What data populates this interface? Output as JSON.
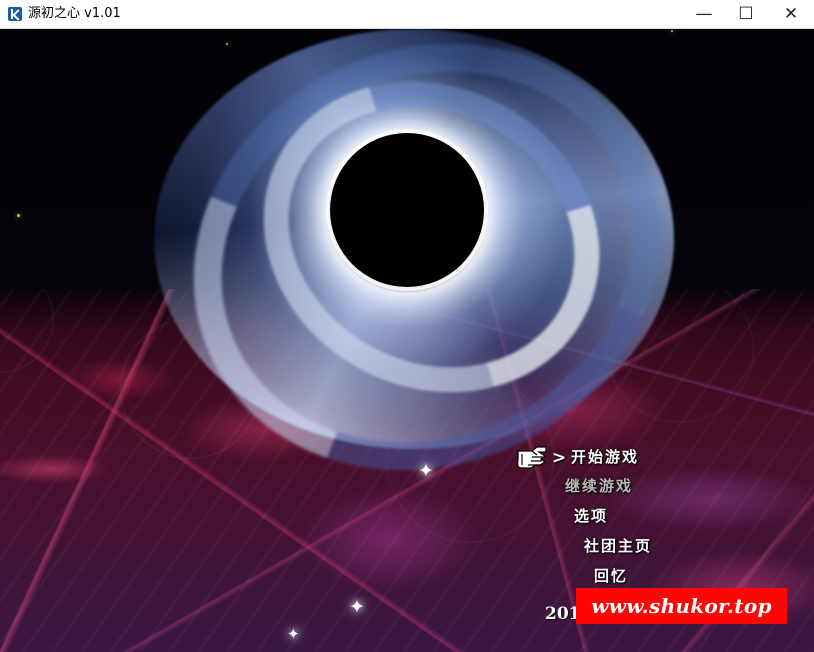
{
  "window": {
    "title": "源初之心 v1.01",
    "controls": {
      "minimize": "—",
      "maximize": "☐",
      "close": "✕"
    }
  },
  "menu": {
    "items": [
      {
        "label": "开始游戏",
        "selected": true
      },
      {
        "label": "继续游戏",
        "disabled": true
      },
      {
        "label": "选项"
      },
      {
        "label": "社团主页"
      },
      {
        "label": "回忆"
      }
    ],
    "selection_arrow": ">"
  },
  "footer": {
    "visible_year_prefix": "201"
  },
  "watermark": {
    "text": "www.shukor.top"
  },
  "decorations": {
    "sparkle_glyph": "✦"
  }
}
